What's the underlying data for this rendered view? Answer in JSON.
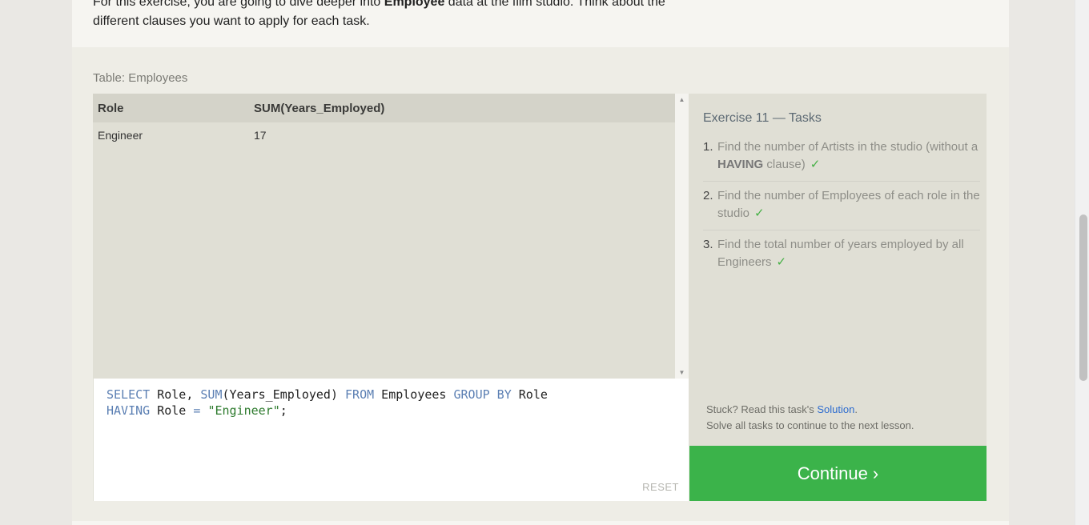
{
  "intro": {
    "line1_before": "For this exercise, you are going to dive deeper into ",
    "line1_bold": "Employee",
    "line1_after": " data at the film studio. Think about the",
    "line2": "different clauses you want to apply for each task."
  },
  "table": {
    "caption": "Table: Employees",
    "headers": [
      "Role",
      "SUM(Years_Employed)"
    ],
    "rows": [
      [
        "Engineer",
        "17"
      ]
    ]
  },
  "editor": {
    "line1": {
      "k1": "SELECT",
      "t1": " Role, ",
      "k2": "SUM",
      "t2": "(Years_Employed) ",
      "k3": "FROM",
      "t3": " Employees ",
      "k4": "GROUP BY",
      "t4": " Role"
    },
    "line2": {
      "k1": "HAVING",
      "t1": " Role ",
      "k2": "=",
      "t2": " ",
      "s1": "\"Engineer\"",
      "t3": ";"
    },
    "reset_label": "RESET"
  },
  "tasks": {
    "title": "Exercise 11 — Tasks",
    "items": [
      {
        "num": "1.",
        "text_a": "Find the number of Artists in the studio (without a ",
        "bold": "HAVING",
        "text_b": " clause)",
        "check": "✓"
      },
      {
        "num": "2.",
        "text_a": "Find the number of Employees of each role in the studio",
        "bold": "",
        "text_b": "",
        "check": "✓"
      },
      {
        "num": "3.",
        "text_a": "Find the total number of years employed by all Engineers",
        "bold": "",
        "text_b": "",
        "check": "✓"
      }
    ],
    "stuck_prefix": "Stuck? Read this task's ",
    "solution_link": "Solution",
    "stuck_suffix": ".",
    "solve_all": "Solve all tasks to continue to the next lesson."
  },
  "continue_label": "Continue ›",
  "colors": {
    "continue_bg": "#3bb34a",
    "keyword": "#5b7fb3",
    "string": "#2d7a2d",
    "link": "#2d6ccf"
  }
}
